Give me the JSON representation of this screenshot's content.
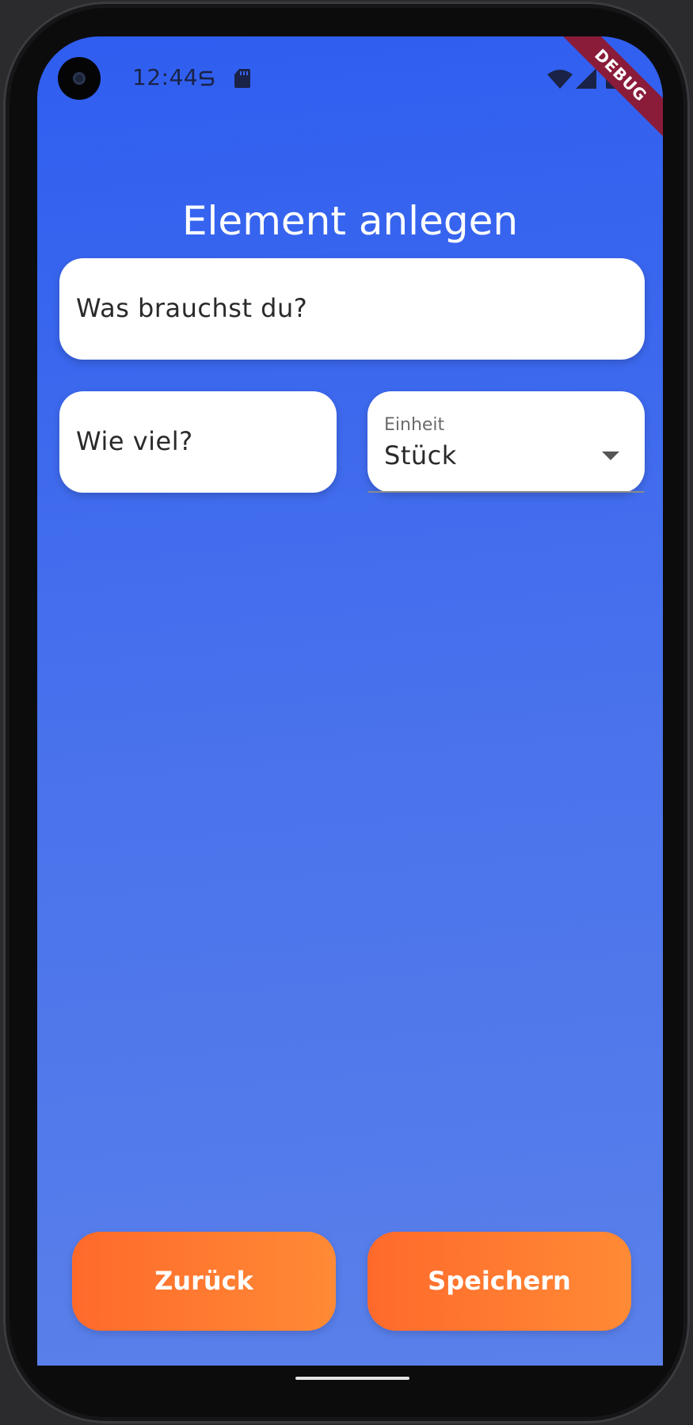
{
  "status_bar": {
    "time": "12:44",
    "debug_label": "DEBUG"
  },
  "page": {
    "title": "Element anlegen"
  },
  "form": {
    "item": {
      "placeholder": "Was brauchst du?"
    },
    "quantity": {
      "placeholder": "Wie viel?"
    },
    "unit": {
      "label": "Einheit",
      "selected": "Stück"
    }
  },
  "buttons": {
    "back": "Zurück",
    "save": "Speichern"
  },
  "colors": {
    "background_top": "#2f5ef0",
    "background_bottom": "#5a80ea",
    "button_start": "#ff6a2b",
    "button_end": "#ff8a35",
    "debug_banner": "#8a1c3a"
  }
}
